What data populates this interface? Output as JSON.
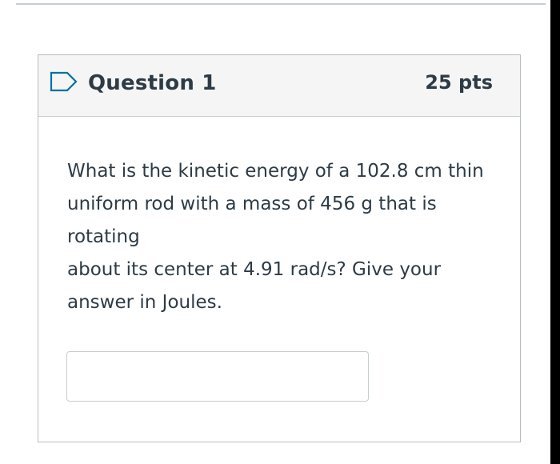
{
  "question": {
    "title": "Question 1",
    "points": "25 pts",
    "flag_icon": "flag-outline-icon",
    "text_lines": [
      "What is the kinetic energy of a 102.8 cm thin",
      "uniform rod with a mass of 456 g that is",
      "rotating",
      "about its center at 4.91 rad/s? Give your",
      "answer in Joules."
    ],
    "answer": {
      "value": "",
      "placeholder": ""
    }
  },
  "colors": {
    "text": "#2d3b45",
    "header_bg": "#f5f5f5",
    "border": "#c7cdd1",
    "flag_stroke": "#0770a3"
  }
}
